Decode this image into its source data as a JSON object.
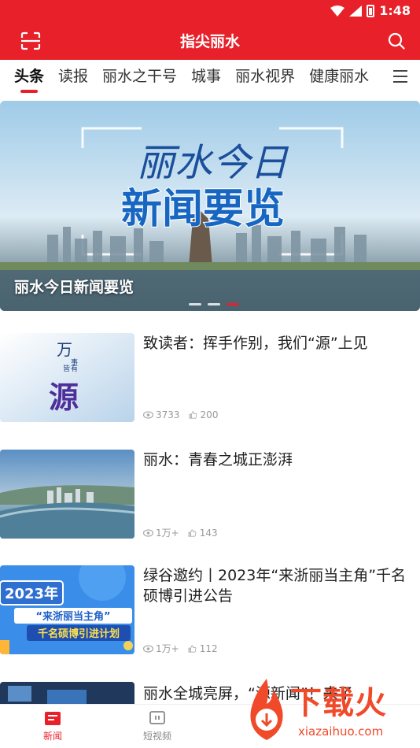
{
  "status_bar": {
    "time": "1:48"
  },
  "app_bar": {
    "title": "指尖丽水"
  },
  "tabs": [
    {
      "label": "头条",
      "active": true
    },
    {
      "label": "读报"
    },
    {
      "label": "丽水之干号"
    },
    {
      "label": "城事"
    },
    {
      "label": "丽水视界"
    },
    {
      "label": "健康丽水"
    }
  ],
  "banner": {
    "image_text_line1": "丽水今日",
    "image_text_line2": "新闻要览",
    "caption": "丽水今日新闻要览"
  },
  "news": [
    {
      "title": "致读者：挥手作别，我们“源”上见",
      "views": "3733",
      "likes": "200",
      "thumb_text": [
        "万",
        "事",
        "皆",
        "有",
        "源"
      ]
    },
    {
      "title": "丽水：青春之城正澎湃",
      "views": "1万+",
      "likes": "143"
    },
    {
      "title": "绿谷邀约丨2023年“来浙丽当主角”千名硕博引进公告",
      "views": "1万+",
      "likes": "112",
      "thumb_text": [
        "2023年",
        "“来浙丽当主角”",
        "千名硕博引进计划"
      ]
    },
    {
      "title": "丽水全城亮屏，“源新闻”！来了"
    }
  ],
  "bottom_nav": [
    {
      "label": "新闻",
      "active": true
    },
    {
      "label": "短视频"
    }
  ],
  "watermark": {
    "text": "下载火",
    "url": "xiazaihuo.com"
  },
  "colors": {
    "accent": "#e8202a",
    "watermark": "#f04a2b"
  }
}
